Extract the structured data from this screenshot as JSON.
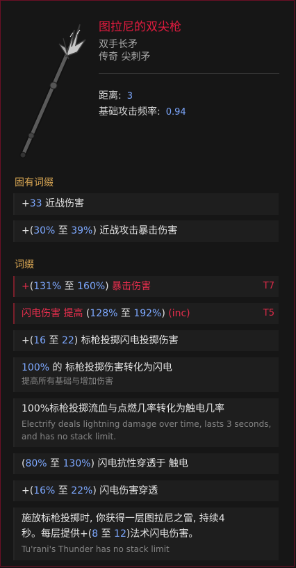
{
  "item": {
    "name": "图拉尼的双尖枪",
    "type": "双手长矛",
    "rarity": "传奇 尖刺矛"
  },
  "stats": [
    {
      "label": "距离:",
      "value": "3"
    },
    {
      "label": "基础攻击频率:",
      "value": "0.94"
    }
  ],
  "implicit": {
    "title": "固有词缀",
    "lines": [
      {
        "p1": "+",
        "n1": "33",
        "t1": " 近战伤害"
      },
      {
        "p1": "+(",
        "n1": "30%",
        "mid": " 至 ",
        "n2": "39%",
        "t1": ") 近战攻击暴击伤害"
      }
    ]
  },
  "affixes": {
    "title": "词缀",
    "lines": [
      {
        "plus": "+",
        "open": "(",
        "n1": "131%",
        "mid": " 至 ",
        "n2": "160%",
        "close": ")",
        "label": " 暴击伤害",
        "tier": "T7"
      },
      {
        "label": "闪电伤害 提高",
        "open": " (",
        "n1": "128%",
        "mid": " 至 ",
        "n2": "192%",
        "close": ")",
        "suffix": " (inc)",
        "tier": "T5"
      },
      {
        "p1": "+(",
        "n1": "16",
        "mid": " 至 ",
        "n2": "22",
        "t1": ") 标枪投掷闪电投掷伤害"
      },
      {
        "n1": "100%",
        "t1": " 的 标枪投掷伤害转化为闪电",
        "desc": "提高所有基础与增加伤害"
      },
      {
        "t1": "100%标枪投掷流血与点燃几率转化为触电几率",
        "desc": "Electrify deals lightning damage over time, lasts 3 seconds, and has no stack limit."
      },
      {
        "p1": "(",
        "n1": "80%",
        "mid": " 至 ",
        "n2": "130%",
        "t1": ") 闪电抗性穿透于 触电"
      },
      {
        "p1": "+(",
        "n1": "16%",
        "mid": " 至 ",
        "n2": "22%",
        "t1": ") 闪电伤害穿透"
      },
      {
        "t1": "施放标枪投掷时, 你获得一层图拉尼之雷, 持续4",
        "t2": "秒。每层提供+(",
        "n1": "8",
        "mid": " 至 ",
        "n2": "12",
        "t3": ")法术闪电伤害。",
        "desc": "Tu'rani's Thunder has no stack limit"
      }
    ]
  },
  "colors": {
    "name": "#e31b3f",
    "section": "#d7a553",
    "number": "#7da8ff",
    "tier": "#e02b4a",
    "border": "#6a1025"
  }
}
